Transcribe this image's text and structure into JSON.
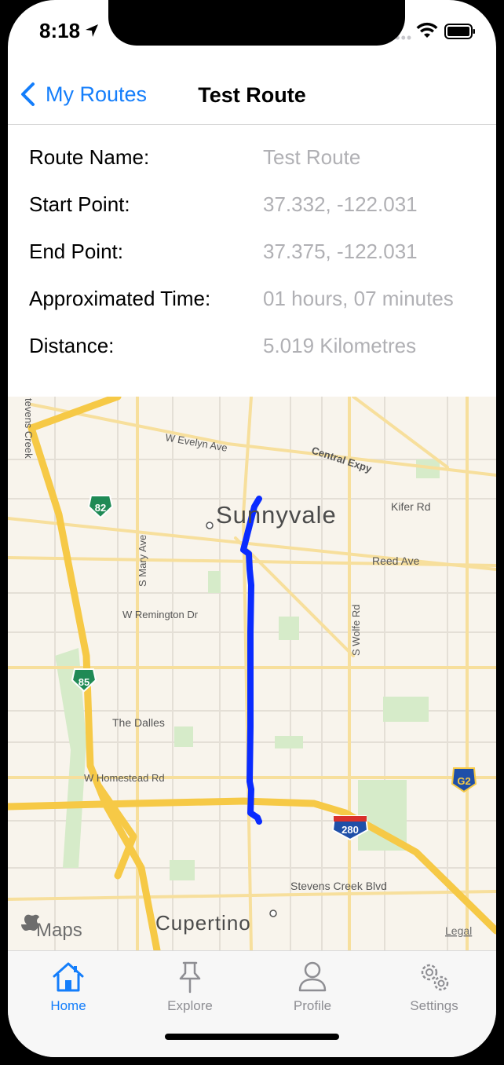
{
  "status_bar": {
    "time": "8:18"
  },
  "nav": {
    "back_label": "My Routes",
    "title": "Test Route"
  },
  "details": [
    {
      "label": "Route Name:",
      "value": "Test Route"
    },
    {
      "label": "Start Point:",
      "value": "37.332, -122.031"
    },
    {
      "label": "End Point:",
      "value": "37.375, -122.031"
    },
    {
      "label": "Approximated Time:",
      "value": "01 hours, 07 minutes"
    },
    {
      "label": "Distance:",
      "value": "5.019 Kilometres"
    }
  ],
  "map": {
    "city_labels": [
      "Sunnyvale",
      "Cupertino"
    ],
    "street_labels": [
      "W Evelyn Ave",
      "Central Expy",
      "Kifer Rd",
      "Reed Ave",
      "S Mary Ave",
      "W Remington Dr",
      "S Wolfe Rd",
      "The Dalles",
      "W Homestead Rd",
      "Stevens Creek Blvd",
      "tevens Creek"
    ],
    "shields": [
      "82",
      "85",
      "280",
      "G2"
    ],
    "attribution": "Maps",
    "legal": "Legal",
    "route_color": "#0a2bff"
  },
  "tabs": [
    {
      "label": "Home",
      "icon": "house-icon",
      "active": true
    },
    {
      "label": "Explore",
      "icon": "pin-icon",
      "active": false
    },
    {
      "label": "Profile",
      "icon": "person-icon",
      "active": false
    },
    {
      "label": "Settings",
      "icon": "gear-icon",
      "active": false
    }
  ],
  "colors": {
    "accent": "#147efb",
    "secondary_text": "#b0b0b4"
  }
}
